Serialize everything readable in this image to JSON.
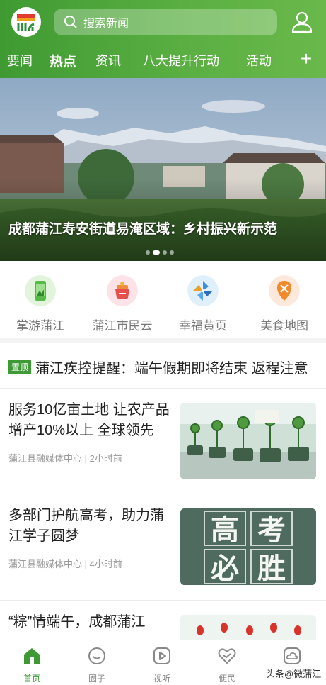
{
  "header": {
    "search_placeholder": "搜索新闻",
    "tabs": [
      "要闻",
      "热点",
      "资讯",
      "八大提升行动",
      "活动"
    ],
    "add_label": "+"
  },
  "banner": {
    "caption": "成都蒲江寿安街道易淹区域：乡村振兴新示范"
  },
  "quick_nav": [
    {
      "label": "掌游蒲江",
      "icon": "phone-icon"
    },
    {
      "label": "蒲江市民云",
      "icon": "teapot-icon"
    },
    {
      "label": "幸福黄页",
      "icon": "pinwheel-icon"
    },
    {
      "label": "美食地图",
      "icon": "food-map-icon"
    }
  ],
  "pinned": {
    "badge": "置顶",
    "title": "蒲江疾控提醒：端午假期即将结束 返程注意"
  },
  "news": [
    {
      "title": "服务10亿亩土地 让农产品增产10%以上 全球领先",
      "meta": "蒲江县融媒体中心 | 2小时前"
    },
    {
      "title": "多部门护航高考，助力蒲江学子圆梦",
      "meta": "蒲江县融媒体中心 | 4小时前",
      "thumb_text": [
        "高",
        "考",
        "必",
        "胜"
      ]
    },
    {
      "title": "“粽”情端午，成都蒲江"
    }
  ],
  "bottom_nav": [
    {
      "label": "首页",
      "icon": "home-icon"
    },
    {
      "label": "圈子",
      "icon": "smile-icon"
    },
    {
      "label": "视听",
      "icon": "play-icon"
    },
    {
      "label": "便民",
      "icon": "heart-hands-icon"
    },
    {
      "label": "云",
      "icon": "cloud-icon"
    }
  ],
  "watermark": "头条@微蒲江",
  "colors": {
    "brand": "#3d9a34",
    "header_start": "#3f9a32",
    "header_end": "#6ab84b"
  }
}
